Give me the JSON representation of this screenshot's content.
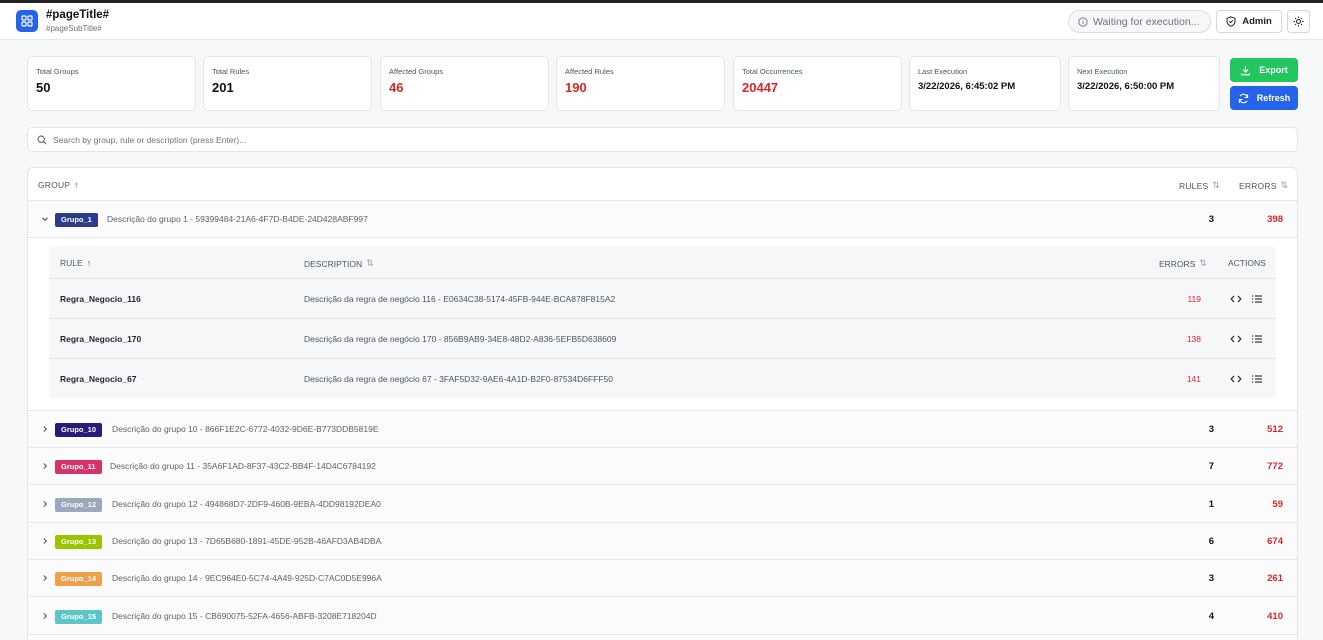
{
  "header": {
    "title": "#pageTitle#",
    "subtitle": "#pageSubTitle#",
    "status": "Waiting for execution...",
    "admin_label": "Admin"
  },
  "stats": [
    {
      "label": "Total Groups",
      "value": "50",
      "tone": "default"
    },
    {
      "label": "Total Rules",
      "value": "201",
      "tone": "default"
    },
    {
      "label": "Affected Groups",
      "value": "46",
      "tone": "red"
    },
    {
      "label": "Affected Rules",
      "value": "190",
      "tone": "red"
    },
    {
      "label": "Total Occurrences",
      "value": "20447",
      "tone": "red"
    },
    {
      "label": "Last Execution",
      "value": "3/22/2026, 6:45:02 PM",
      "tone": "small"
    },
    {
      "label": "Next Execution",
      "value": "3/22/2026, 6:50:00 PM",
      "tone": "small"
    }
  ],
  "actions": {
    "export_label": "Export",
    "refresh_label": "Refresh"
  },
  "search": {
    "placeholder": "Search by group, rule or description (press Enter)...",
    "value": ""
  },
  "table": {
    "columns": {
      "group": "GROUP",
      "rules": "RULES",
      "errors": "ERRORS"
    },
    "groups": [
      {
        "name": "Grupo_1",
        "color": "#2c3a8c",
        "description": "Descrição do grupo 1 - 59399484-21A6-4F7D-B4DE-24D428ABF997",
        "rules": "3",
        "errors": "398",
        "expanded": true
      },
      {
        "name": "Grupo_10",
        "color": "#2a1a7a",
        "description": "Descrição do grupo 10 - 866F1E2C-6772-4032-9D6E-B773DDB5819E",
        "rules": "3",
        "errors": "512",
        "expanded": false
      },
      {
        "name": "Grupo_11",
        "color": "#d6336c",
        "description": "Descrição do grupo 11 - 35A6F1AD-8F37-43C2-BB4F-14D4C6784192",
        "rules": "7",
        "errors": "772",
        "expanded": false
      },
      {
        "name": "Grupo_12",
        "color": "#9aa7bd",
        "description": "Descrição do grupo 12 - 494868D7-2DF9-460B-9EBA-4DD98192DEA0",
        "rules": "1",
        "errors": "59",
        "expanded": false
      },
      {
        "name": "Grupo_13",
        "color": "#9bc400",
        "description": "Descrição do grupo 13 - 7D65B680-1891-45DE-952B-46AFD3AB4DBA",
        "rules": "6",
        "errors": "674",
        "expanded": false
      },
      {
        "name": "Grupo_14",
        "color": "#f0a04b",
        "description": "Descrição do grupo 14 - 9EC964E0-5C74-4A49-925D-C7AC0D5E996A",
        "rules": "3",
        "errors": "261",
        "expanded": false
      },
      {
        "name": "Grupo_15",
        "color": "#5cc6c6",
        "description": "Descrição do grupo 15 - CB690075-52FA-4656-ABFB-3208E718204D",
        "rules": "4",
        "errors": "410",
        "expanded": false
      }
    ]
  },
  "rules_table": {
    "columns": {
      "rule": "RULE",
      "description": "DESCRIPTION",
      "errors": "ERRORS",
      "actions": "ACTIONS"
    },
    "rows": [
      {
        "name": "Regra_Negocio_116",
        "description": "Descrição da regra de negócio 116 - E0634C38-5174-45FB-944E-BCA878F815A2",
        "errors": "119"
      },
      {
        "name": "Regra_Negocio_170",
        "description": "Descrição da regra de negócio 170 - 856B9AB9-34E8-48D2-A836-5EFB5D638609",
        "errors": "138"
      },
      {
        "name": "Regra_Negocio_67",
        "description": "Descrição da regra de negócio 67 - 3FAF5D32-9AE6-4A1D-B2F0-87534D6FFF50",
        "errors": "141"
      }
    ]
  }
}
